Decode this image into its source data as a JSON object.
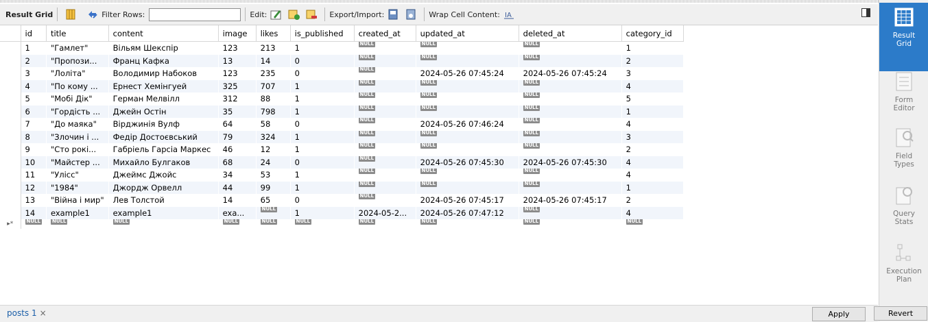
{
  "toolbar": {
    "result_grid_label": "Result Grid",
    "filter_rows_label": "Filter Rows:",
    "filter_rows_value": "",
    "edit_label": "Edit:",
    "export_import_label": "Export/Import:",
    "wrap_cell_label": "Wrap Cell Content:"
  },
  "grid": {
    "columns": [
      "id",
      "title",
      "content",
      "image",
      "likes",
      "is_published",
      "created_at",
      "updated_at",
      "deleted_at",
      "category_id"
    ],
    "null_label": "NULL",
    "new_row_marker": "▸*",
    "rows": [
      [
        "1",
        "\"Гамлет\"",
        "Вільям Шекспір",
        "123",
        "213",
        "1",
        null,
        null,
        null,
        "1"
      ],
      [
        "2",
        "\"Пропози...",
        "Франц Кафка",
        "13",
        "14",
        "0",
        null,
        null,
        null,
        "2"
      ],
      [
        "3",
        "\"Лоліта\"",
        "Володимир Набоков",
        "123",
        "235",
        "0",
        null,
        "2024-05-26 07:45:24",
        "2024-05-26 07:45:24",
        "3"
      ],
      [
        "4",
        "\"По кому ...",
        "Ернест Хемінгуей",
        "325",
        "707",
        "1",
        null,
        null,
        null,
        "4"
      ],
      [
        "5",
        "\"Мобі Дік\"",
        "Герман Мелвілл",
        "312",
        "88",
        "1",
        null,
        null,
        null,
        "5"
      ],
      [
        "6",
        "\"Гордість ...",
        "Джейн Остін",
        "35",
        "798",
        "1",
        null,
        null,
        null,
        "1"
      ],
      [
        "7",
        "\"До маяка\"",
        "Вірджинія Вулф",
        "64",
        "58",
        "0",
        null,
        "2024-05-26 07:46:24",
        null,
        "4"
      ],
      [
        "8",
        "\"Злочин і ...",
        "Федір Достоєвський",
        "79",
        "324",
        "1",
        null,
        null,
        null,
        "3"
      ],
      [
        "9",
        "\"Сто рокі...",
        "Габріель Гарсіа Маркес",
        "46",
        "12",
        "1",
        null,
        null,
        null,
        "2"
      ],
      [
        "10",
        "\"Майстер ...",
        "Михайло Булгаков",
        "68",
        "24",
        "0",
        null,
        "2024-05-26 07:45:30",
        "2024-05-26 07:45:30",
        "4"
      ],
      [
        "11",
        "\"Улісс\"",
        "Джеймс Джойс",
        "34",
        "53",
        "1",
        null,
        null,
        null,
        "4"
      ],
      [
        "12",
        "\"1984\"",
        "Джордж Орвелл",
        "44",
        "99",
        "1",
        null,
        null,
        null,
        "1"
      ],
      [
        "13",
        "\"Війна і мир\"",
        "Лев Толстой",
        "14",
        "65",
        "0",
        null,
        "2024-05-26 07:45:17",
        "2024-05-26 07:45:17",
        "2"
      ],
      [
        "14",
        "example1",
        "example1",
        "exa...",
        null,
        "1",
        "2024-05-2...",
        "2024-05-26 07:47:12",
        null,
        "4"
      ]
    ]
  },
  "bottom": {
    "tab_label": "posts 1",
    "tab_close": "×",
    "apply_label": "Apply",
    "revert_label": "Revert"
  },
  "right_panel": {
    "items": [
      {
        "label": "Result Grid",
        "active": true
      },
      {
        "label": "Form Editor",
        "active": false
      },
      {
        "label": "Field Types",
        "active": false
      },
      {
        "label": "Query Stats",
        "active": false
      },
      {
        "label": "Execution Plan",
        "active": false
      }
    ]
  }
}
